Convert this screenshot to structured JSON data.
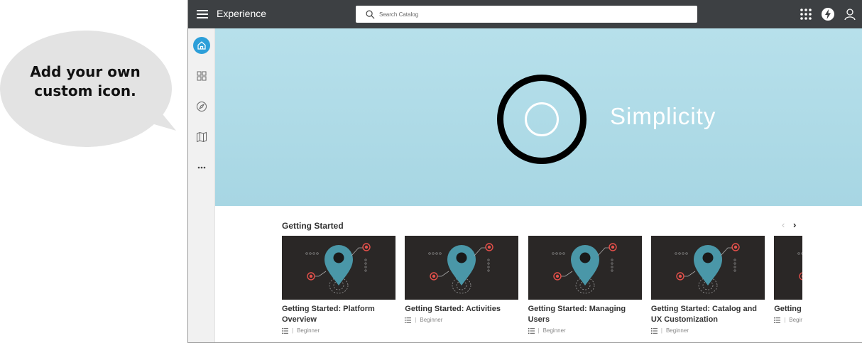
{
  "callout": {
    "line1": "Add your own",
    "line2": "custom icon."
  },
  "header": {
    "title": "Experience",
    "search_placeholder": "Search Catalog"
  },
  "sidebar": {
    "items": [
      "home-icon",
      "grid-icon",
      "compass-icon",
      "map-icon",
      "more-icon"
    ]
  },
  "hero": {
    "word": "Simplicity"
  },
  "section": {
    "title": "Getting Started",
    "prev": "‹",
    "next": "›"
  },
  "cards": [
    {
      "title": "Getting Started: Platform Overview",
      "level": "Beginner"
    },
    {
      "title": "Getting Started: Activities",
      "level": "Beginner"
    },
    {
      "title": "Getting Started: Managing Users",
      "level": "Beginner"
    },
    {
      "title": "Getting Started: Catalog and UX Customization",
      "level": "Beginner"
    },
    {
      "title": "Getting Automa",
      "level": "Begin"
    }
  ],
  "colors": {
    "topbar": "#3d4043",
    "accent": "#2d9fd9",
    "pin": "#4a97a8",
    "target": "#e6504a"
  }
}
